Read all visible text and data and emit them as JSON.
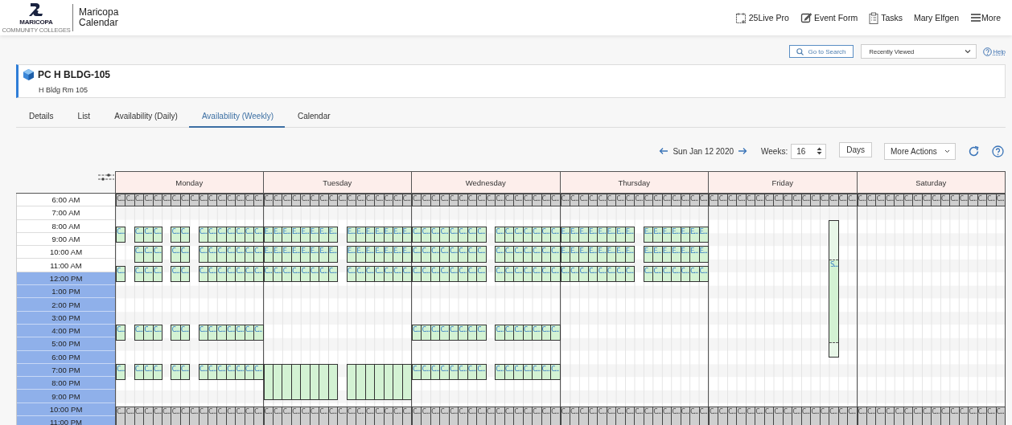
{
  "app": {
    "logo_wordmark": "MARICOPA",
    "logo_tagline": "COMMUNITY COLLEGES",
    "title_lines": [
      "Maricopa",
      "Calendar"
    ]
  },
  "nav": [
    {
      "label": "25Live Pro",
      "kind": "calendar"
    },
    {
      "label": "Event Form",
      "kind": "edit"
    },
    {
      "label": "Tasks",
      "kind": "tasks"
    },
    {
      "label": "Mary Elfgen",
      "kind": "user"
    },
    {
      "label": "More",
      "kind": "menu"
    }
  ],
  "toolbar": {
    "search_button": "Go to Search",
    "recent_select": "Recently Viewed",
    "help": "Help"
  },
  "resource": {
    "name": "PC H BLDG-105",
    "subtitle": "H Bldg Rm 105"
  },
  "tabs": [
    {
      "label": "Details",
      "selected": false
    },
    {
      "label": "List",
      "selected": false
    },
    {
      "label": "Availability (Daily)",
      "selected": false
    },
    {
      "label": "Availability (Weekly)",
      "selected": true
    },
    {
      "label": "Calendar",
      "selected": false
    }
  ],
  "controls": {
    "date": "Sun Jan 12 2020",
    "weeks_label": "Weeks:",
    "weeks": "16",
    "days_button": "Days",
    "more_actions": "More Actions"
  },
  "grid": {
    "times": [
      {
        "label": "6:00 AM",
        "highlighted": false
      },
      {
        "label": "7:00 AM",
        "highlighted": false
      },
      {
        "label": "8:00 AM",
        "highlighted": false
      },
      {
        "label": "9:00 AM",
        "highlighted": false
      },
      {
        "label": "10:00 AM",
        "highlighted": false
      },
      {
        "label": "11:00 AM",
        "highlighted": false
      },
      {
        "label": "12:00 PM",
        "highlighted": true
      },
      {
        "label": "1:00 PM",
        "highlighted": true
      },
      {
        "label": "2:00 PM",
        "highlighted": true
      },
      {
        "label": "3:00 PM",
        "highlighted": true
      },
      {
        "label": "4:00 PM",
        "highlighted": true
      },
      {
        "label": "5:00 PM",
        "highlighted": true
      },
      {
        "label": "6:00 PM",
        "highlighted": true
      },
      {
        "label": "7:00 PM",
        "highlighted": true
      },
      {
        "label": "8:00 PM",
        "highlighted": true
      },
      {
        "label": "9:00 PM",
        "highlighted": true
      },
      {
        "label": "10:00 PM",
        "highlighted": true
      },
      {
        "label": "11:00 PM",
        "highlighted": true
      }
    ],
    "days": [
      {
        "name": "Monday",
        "bands": [
          {
            "kind": "morning_blackout",
            "cells": [
              "C…",
              "C…",
              "C…",
              "C…",
              "C…",
              "C…",
              "C…",
              "C…",
              "C…",
              "C…",
              "C…",
              "C…",
              "C…",
              "C…",
              "C…",
              "C…"
            ]
          },
          {
            "kind": "first_class",
            "cells": [
              "C…",
              null,
              "C…",
              "C…",
              "C…",
              null,
              "C…",
              "C…",
              null,
              "C…",
              "C…",
              "C…",
              "C…",
              "C…",
              "C…",
              "C…"
            ]
          },
          {
            "kind": "second_class",
            "cells": [
              null,
              null,
              "C…",
              "C…",
              "C…",
              null,
              "C…",
              "C…",
              null,
              "C…",
              "C…",
              "C…",
              "C…",
              "C…",
              "C…",
              "C…"
            ]
          },
          {
            "kind": "third_class",
            "cells": [
              "C…",
              null,
              "C…",
              "C…",
              "C…",
              null,
              "C…",
              "C…",
              null,
              "C…",
              "C…",
              "C…",
              "C…",
              "C…",
              "C…",
              "C…"
            ]
          },
          {
            "kind": "afternoon_class",
            "cells": [
              "C…",
              null,
              "C…",
              "C…",
              "C…",
              null,
              "C…",
              "C…",
              null,
              "C…",
              "C…",
              "C…",
              "C…",
              "C…",
              "C…",
              "C…"
            ]
          },
          {
            "kind": "evening_class",
            "cells": [
              "C…",
              null,
              "C…",
              "C…",
              "C…",
              null,
              "C…",
              "C…",
              null,
              "C…",
              "C…",
              "C…",
              "C…",
              "C…",
              "C…",
              "C…"
            ]
          },
          {
            "kind": "night_blackout",
            "cells": [
              "C…",
              "C…",
              "C…",
              "C…",
              "C…",
              "C…",
              "C…",
              "C…",
              "C…",
              "C…",
              "C…",
              "C…",
              "C…",
              "C…",
              "C…",
              "C…"
            ]
          }
        ]
      },
      {
        "name": "Tuesday",
        "bands": [
          {
            "kind": "morning_blackout",
            "cells": [
              "C…",
              "C…",
              "C…",
              "C…",
              "C…",
              "C…",
              "C…",
              "C…",
              "C…",
              "C…",
              "C…",
              "C…",
              "C…",
              "C…",
              "C…",
              "C…"
            ]
          },
          {
            "kind": "first_class",
            "cells": [
              "E…",
              "E…",
              "E…",
              "E…",
              "E…",
              "E…",
              "E…",
              "E…",
              null,
              "E…",
              "E…",
              "E…",
              "E…",
              "E…",
              "E…",
              "E…"
            ]
          },
          {
            "kind": "second_class",
            "cells": [
              "E…",
              "E…",
              "E…",
              "E…",
              "E…",
              "E…",
              "E…",
              "E…",
              null,
              "E…",
              "E…",
              "E…",
              "E…",
              "E…",
              "E…",
              "E…"
            ]
          },
          {
            "kind": "third_class",
            "cells": [
              "C…",
              "C…",
              "C…",
              "C…",
              "C…",
              "C…",
              "C…",
              "C…",
              null,
              "C…",
              "C…",
              "C…",
              "C…",
              "C…",
              "C…",
              "C…"
            ]
          },
          {
            "kind": "long_evening_class",
            "cells": [
              true,
              true,
              true,
              true,
              true,
              true,
              true,
              true,
              null,
              true,
              true,
              true,
              true,
              true,
              true,
              true
            ]
          },
          {
            "kind": "night_blackout",
            "cells": [
              "C…",
              "C…",
              "C…",
              "C…",
              "C…",
              "C…",
              "C…",
              "C…",
              "C…",
              "C…",
              "C…",
              "C…",
              "C…",
              "C…",
              "C…",
              "C…"
            ]
          }
        ]
      },
      {
        "name": "Wednesday",
        "bands": [
          {
            "kind": "morning_blackout",
            "cells": [
              "C…",
              "C…",
              "C…",
              "C…",
              "C…",
              "C…",
              "C…",
              "C…",
              "C…",
              "C…",
              "C…",
              "C…",
              "C…",
              "C…",
              "C…",
              "C…"
            ]
          },
          {
            "kind": "first_class",
            "cells": [
              "C…",
              "C…",
              "C…",
              "C…",
              "C…",
              "C…",
              "C…",
              "C…",
              null,
              "C…",
              "C…",
              "C…",
              "C…",
              "C…",
              "C…",
              "C…"
            ]
          },
          {
            "kind": "second_class",
            "cells": [
              "C…",
              "C…",
              "C…",
              "C…",
              "C…",
              "C…",
              "C…",
              "C…",
              null,
              "C…",
              "C…",
              "C…",
              "C…",
              "C…",
              "C…",
              "C…"
            ]
          },
          {
            "kind": "third_class",
            "cells": [
              "C…",
              "C…",
              "C…",
              "C…",
              "C…",
              "C…",
              "C…",
              "C…",
              null,
              "C…",
              "C…",
              "C…",
              "C…",
              "C…",
              "C…",
              "C…"
            ]
          },
          {
            "kind": "afternoon_class",
            "cells": [
              "C…",
              "C…",
              "C…",
              "C…",
              "C…",
              "C…",
              "C…",
              "C…",
              null,
              "C…",
              "C…",
              "C…",
              "C…",
              "C…",
              "C…",
              "C…"
            ]
          },
          {
            "kind": "evening_class",
            "cells": [
              "C…",
              "C…",
              "C…",
              "C…",
              "C…",
              "C…",
              "C…",
              "C…",
              null,
              "C…",
              "C…",
              "C…",
              "C…",
              "C…",
              "C…",
              "C…"
            ]
          },
          {
            "kind": "night_blackout",
            "cells": [
              "C…",
              "C…",
              "C…",
              "C…",
              "C…",
              "C…",
              "C…",
              "C…",
              "C…",
              "C…",
              "C…",
              "C…",
              "C…",
              "C…",
              "C…",
              "C…"
            ]
          }
        ]
      },
      {
        "name": "Thursday",
        "bands": [
          {
            "kind": "morning_blackout",
            "cells": [
              "C…",
              "C…",
              "C…",
              "C…",
              "C…",
              "C…",
              "C…",
              "C…",
              "C…",
              "C…",
              "C…",
              "C…",
              "C…",
              "C…",
              "C…",
              "C…"
            ]
          },
          {
            "kind": "first_class",
            "cells": [
              "E…",
              "E…",
              "E…",
              "E…",
              "E…",
              "E…",
              "E…",
              "E…",
              null,
              "E…",
              "E…",
              "E…",
              "E…",
              "E…",
              "E…",
              "E…"
            ]
          },
          {
            "kind": "second_class",
            "cells": [
              "E…",
              "E…",
              "E…",
              "E…",
              "E…",
              "E…",
              "E…",
              "E…",
              null,
              "E…",
              "E…",
              "E…",
              "E…",
              "E…",
              "E…",
              "E…"
            ]
          },
          {
            "kind": "third_class",
            "cells": [
              "C…",
              "C…",
              "C…",
              "C…",
              "C…",
              "C…",
              "C…",
              "C…",
              null,
              "C…",
              "C…",
              "C…",
              "C…",
              "C…",
              "C…",
              "C…"
            ]
          },
          {
            "kind": "night_blackout",
            "cells": [
              "C…",
              "C…",
              "C…",
              "C…",
              "C…",
              "C…",
              "C…",
              "C…",
              "C…",
              "C…",
              "C…",
              "C…",
              "C…",
              "C…",
              "C…",
              "C…"
            ]
          }
        ]
      },
      {
        "name": "Friday",
        "bands": [
          {
            "kind": "morning_blackout",
            "cells": [
              "C…",
              "C…",
              "C…",
              "C…",
              "C…",
              "C…",
              "C…",
              "C…",
              "C…",
              "C…",
              "C…",
              "C…",
              "C…",
              "C…",
              "C…",
              "C…"
            ]
          },
          {
            "kind": "allday_event",
            "cells": [
              null,
              null,
              null,
              null,
              null,
              null,
              null,
              null,
              null,
              null,
              null,
              null,
              null,
              "S…",
              null,
              null
            ]
          },
          {
            "kind": "night_blackout",
            "cells": [
              "C…",
              "C…",
              "C…",
              "C…",
              "C…",
              "C…",
              "C…",
              "C…",
              "C…",
              "C…",
              "C…",
              "C…",
              "C…",
              "C…",
              "C…",
              "C…"
            ]
          }
        ]
      },
      {
        "name": "Saturday",
        "bands": [
          {
            "kind": "morning_blackout",
            "cells": [
              "C…",
              "C…",
              "C…",
              "C…",
              "C…",
              "C…",
              "C…",
              "C…",
              "C…",
              "C…",
              "C…",
              "C…",
              "C…",
              "C…",
              "C…",
              "C…"
            ]
          },
          {
            "kind": "night_blackout",
            "cells": [
              "C…",
              "C…",
              "C…",
              "C…",
              "C…",
              "C…",
              "C…",
              "C…",
              "C…",
              "C…",
              "C…",
              "C…",
              "C…",
              "C…",
              "C…",
              "C…"
            ]
          }
        ]
      }
    ]
  }
}
